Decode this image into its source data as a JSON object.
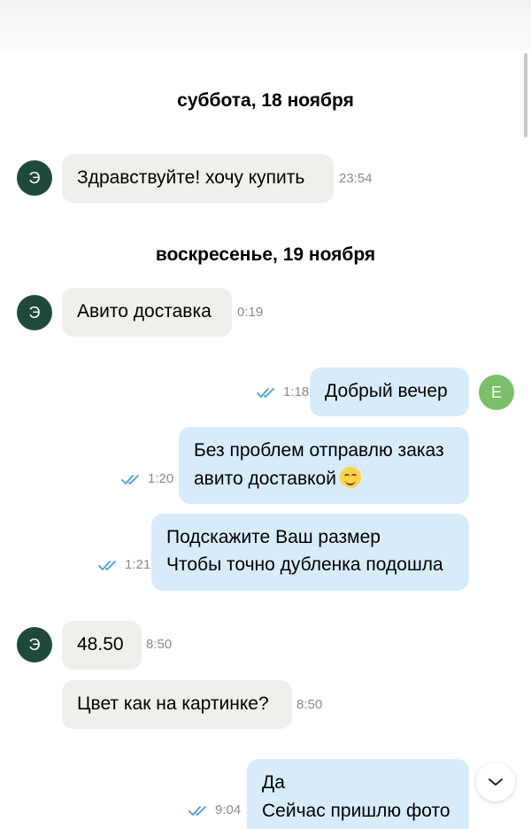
{
  "dates": {
    "day1": "суббота, 18 ноября",
    "day2": "воскресенье, 19 ноября"
  },
  "contact": {
    "avatar_letter": "Э"
  },
  "me": {
    "avatar_letter": "Е"
  },
  "messages": [
    {
      "direction": "in",
      "lines": [
        "Здравствуйте! хочу купить"
      ],
      "time": "23:54"
    },
    {
      "direction": "in",
      "lines": [
        "Авито доставка"
      ],
      "time": "0:19"
    },
    {
      "direction": "out",
      "lines": [
        "Добрый вечер"
      ],
      "time": "1:18",
      "status": "read"
    },
    {
      "direction": "out",
      "lines": [
        "Без проблем отправлю заказ",
        "авито доставкой"
      ],
      "time": "1:20",
      "status": "read",
      "emoji": "smiling-face"
    },
    {
      "direction": "out",
      "lines": [
        "Подскажите Ваш размер",
        "Чтобы точно дубленка подошла"
      ],
      "time": "1:21",
      "status": "read"
    },
    {
      "direction": "in",
      "lines": [
        "48.50"
      ],
      "time": "8:50"
    },
    {
      "direction": "in",
      "lines": [
        "Цвет как на картинке?"
      ],
      "time": "8:50"
    },
    {
      "direction": "out",
      "lines": [
        "Да",
        "Сейчас пришлю фото"
      ],
      "time": "9:04",
      "status": "read"
    }
  ],
  "colors": {
    "incoming_bubble": "#f1efeb",
    "outgoing_bubble": "#d8ebfb",
    "contact_avatar": "#1f4a3a",
    "my_avatar": "#7bbf6a",
    "read_checks": "#4a9ee0"
  },
  "icons": {
    "scroll_down": "chevron-down-icon",
    "read_status": "double-check-icon"
  }
}
